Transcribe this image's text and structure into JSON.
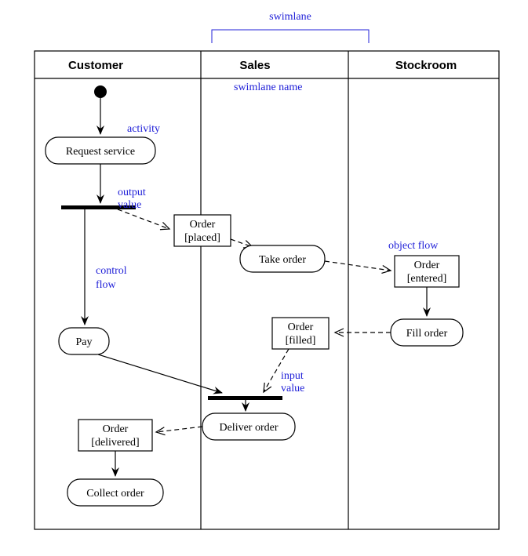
{
  "topAnnotation": "swimlane",
  "swimlaneNameAnnotation": "swimlane name",
  "activityAnnotation": "activity",
  "outputValueAnnotation1": "output",
  "outputValueAnnotation2": "value",
  "controlFlowAnnotation1": "control",
  "controlFlowAnnotation2": "flow",
  "objectFlowAnnotation": "object flow",
  "inputValueAnnotation1": "input",
  "inputValueAnnotation2": "value",
  "lanes": {
    "customer": "Customer",
    "sales": "Sales",
    "stockroom": "Stockroom"
  },
  "activities": {
    "requestService": "Request service",
    "takeOrder": "Take order",
    "pay": "Pay",
    "fillOrder": "Fill order",
    "deliverOrder": "Deliver order",
    "collectOrder": "Collect order"
  },
  "objects": {
    "orderPlaced1": "Order",
    "orderPlaced2": "[placed]",
    "orderEntered1": "Order",
    "orderEntered2": "[entered]",
    "orderFilled1": "Order",
    "orderFilled2": "[filled]",
    "orderDelivered1": "Order",
    "orderDelivered2": "[delivered]"
  }
}
